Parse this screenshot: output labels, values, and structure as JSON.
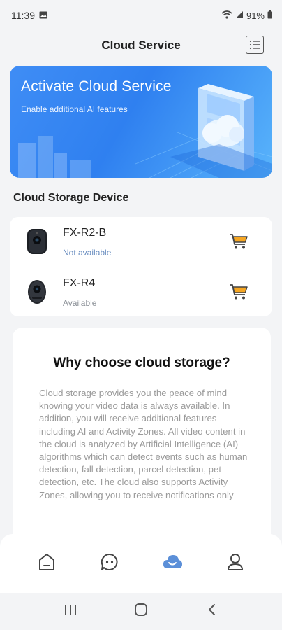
{
  "status_bar": {
    "time": "11:39",
    "battery": "91%"
  },
  "header": {
    "title": "Cloud Service",
    "menu_icon": "list-icon"
  },
  "banner": {
    "title": "Activate Cloud Service",
    "subtitle": "Enable additional AI features",
    "colors": {
      "start": "#3f8df5",
      "end": "#59b4fb"
    }
  },
  "devices_section": {
    "title": "Cloud Storage Device",
    "devices": [
      {
        "name": "FX-R2-B",
        "status": "Not available",
        "cart_icon": "shopping-cart-icon"
      },
      {
        "name": "FX-R4",
        "status": "Available",
        "cart_icon": "shopping-cart-icon"
      }
    ]
  },
  "why": {
    "title": "Why choose cloud storage?",
    "body": "Cloud storage provides you the peace of mind knowing your video data is always available. In addition, you will receive additional features including AI and Activity Zones. All video content in the cloud is analyzed by Artificial Intelligence (AI) algorithms which can detect events such as human detection, fall detection, parcel detection, pet detection, etc. The cloud also supports Activity Zones, allowing you to receive notifications only"
  },
  "bottom_nav": {
    "items": [
      {
        "name": "home",
        "icon": "home-icon",
        "active": false
      },
      {
        "name": "messages",
        "icon": "chat-icon",
        "active": false
      },
      {
        "name": "cloud",
        "icon": "cloud-icon",
        "active": true
      },
      {
        "name": "profile",
        "icon": "person-icon",
        "active": false
      }
    ],
    "active_color": "#5b8fd8",
    "inactive_color": "#444444"
  },
  "colors": {
    "accent": "#f5a623",
    "link_status": "#6a8ec0"
  }
}
